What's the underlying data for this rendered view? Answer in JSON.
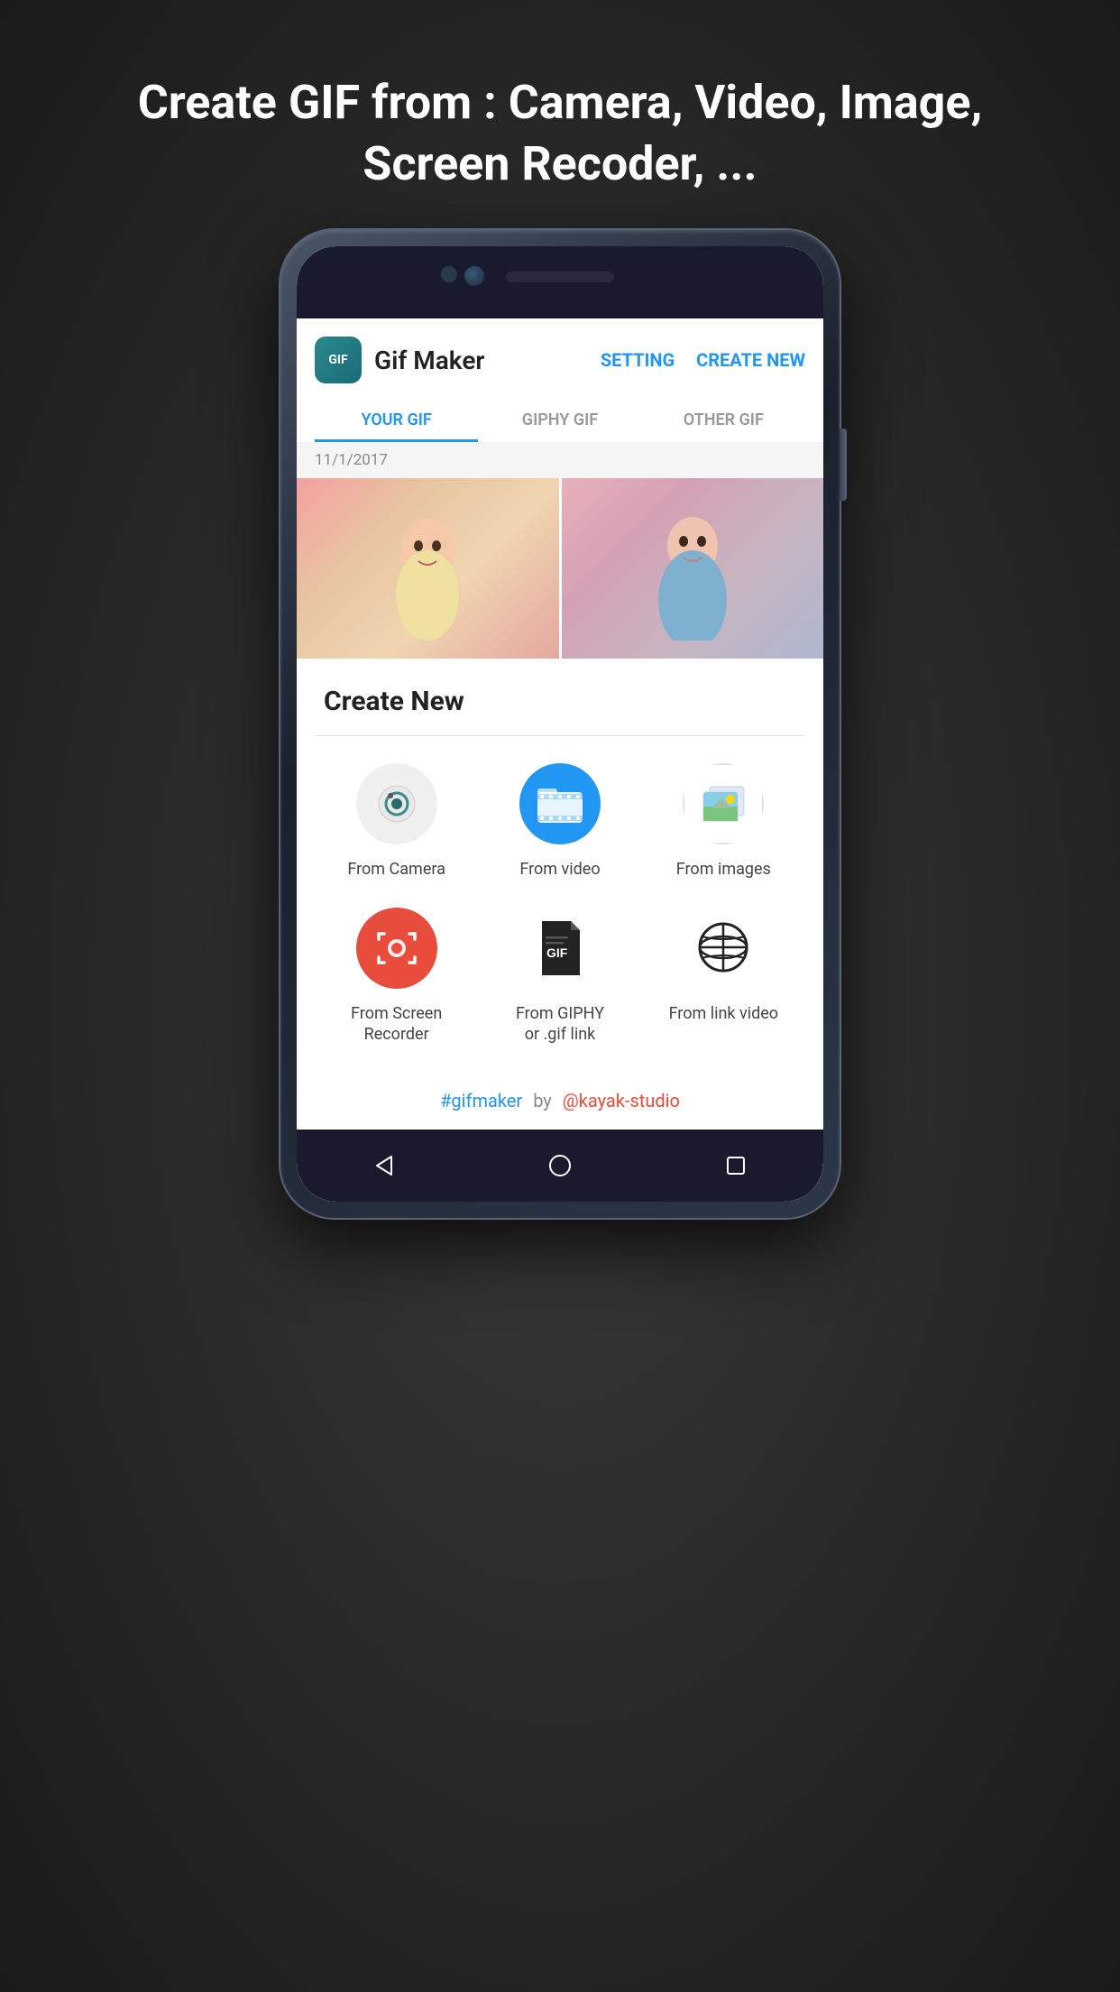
{
  "headline": {
    "prefix": "Create GIF from : ",
    "bold": "Camera, Video, Image, Screen Recoder, ..."
  },
  "app": {
    "logo_text": "GIF",
    "title": "Gif Maker",
    "setting_btn": "SETTING",
    "create_new_btn": "CREATE NEW",
    "tabs": [
      {
        "label": "YOUR GIF",
        "active": true
      },
      {
        "label": "GIPHY GIF",
        "active": false
      },
      {
        "label": "OTHER GIF",
        "active": false
      }
    ],
    "date_label": "11/1/2017"
  },
  "create_new": {
    "title": "Create New",
    "options": [
      {
        "label": "From Camera",
        "icon": "camera-icon"
      },
      {
        "label": "From video",
        "icon": "video-icon"
      },
      {
        "label": "From images",
        "icon": "images-icon"
      },
      {
        "label": "From Screen\nRecorder",
        "icon": "screen-recorder-icon"
      },
      {
        "label": "From GIPHY\nor .gif link",
        "icon": "gif-link-icon"
      },
      {
        "label": "From link video",
        "icon": "globe-icon"
      }
    ],
    "footer": {
      "hashtag": "#gifmaker",
      "by": "by",
      "studio": "@kayak-studio"
    }
  }
}
